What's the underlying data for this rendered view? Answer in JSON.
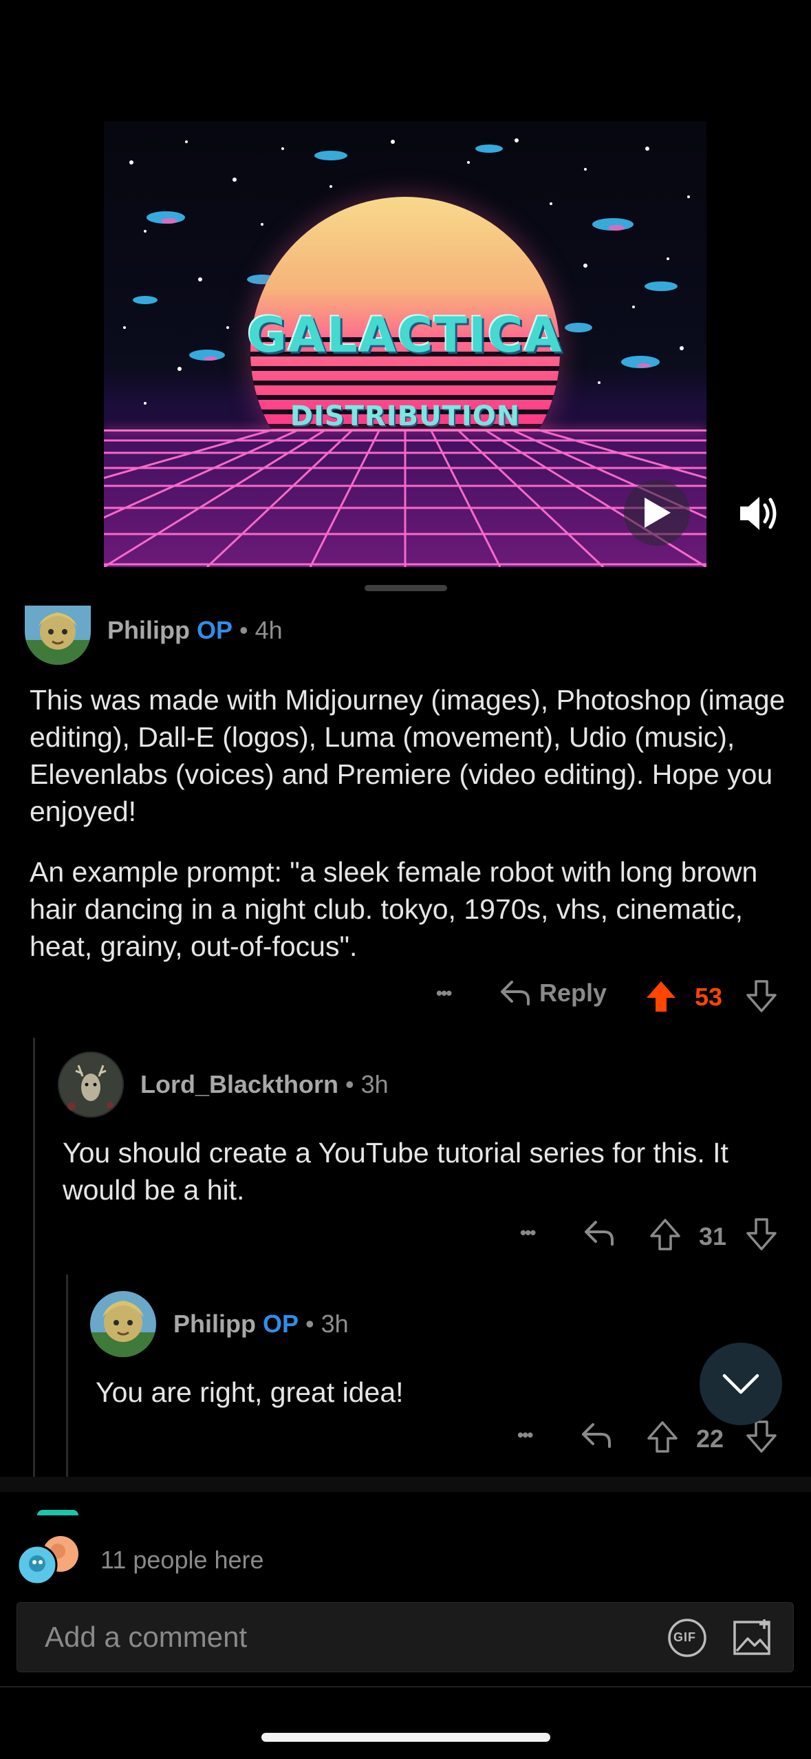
{
  "video": {
    "logo_line1": "GALACTICA",
    "logo_line2": "DISTRIBUTION",
    "play_icon": "play-icon",
    "volume_icon": "volume-icon"
  },
  "comments": [
    {
      "username": "Philipp",
      "op_badge": "OP",
      "separator": "•",
      "time": "4h",
      "paragraphs": [
        "This was made with Midjourney (images), Photoshop (image editing), Dall-E (logos), Luma (movement), Udio (music), Elevenlabs (voices) and Premiere (video editing). Hope you enjoyed!",
        "An example prompt: \"a sleek female robot with long brown hair dancing in a night club. tokyo, 1970s, vhs, cinematic, heat, grainy, out-of-focus\"."
      ],
      "more": "•••",
      "reply_label": "Reply",
      "votes": "53",
      "upvoted": true
    },
    {
      "username": "Lord_Blackthorn",
      "separator": "•",
      "time": "3h",
      "text": "You should create a YouTube tutorial series for this. It would be a hit.",
      "more": "•••",
      "votes": "31"
    },
    {
      "username": "Philipp",
      "op_badge": "OP",
      "separator": "•",
      "time": "3h",
      "text": "You are right, great idea!",
      "more": "•••",
      "votes": "22"
    }
  ],
  "presence": {
    "text": "11 people here"
  },
  "composer": {
    "placeholder": "Add a comment",
    "gif_label": "GIF"
  },
  "colors": {
    "upvote_active": "#ff4500",
    "op_badge": "#2f8fe8",
    "background": "#000000"
  }
}
